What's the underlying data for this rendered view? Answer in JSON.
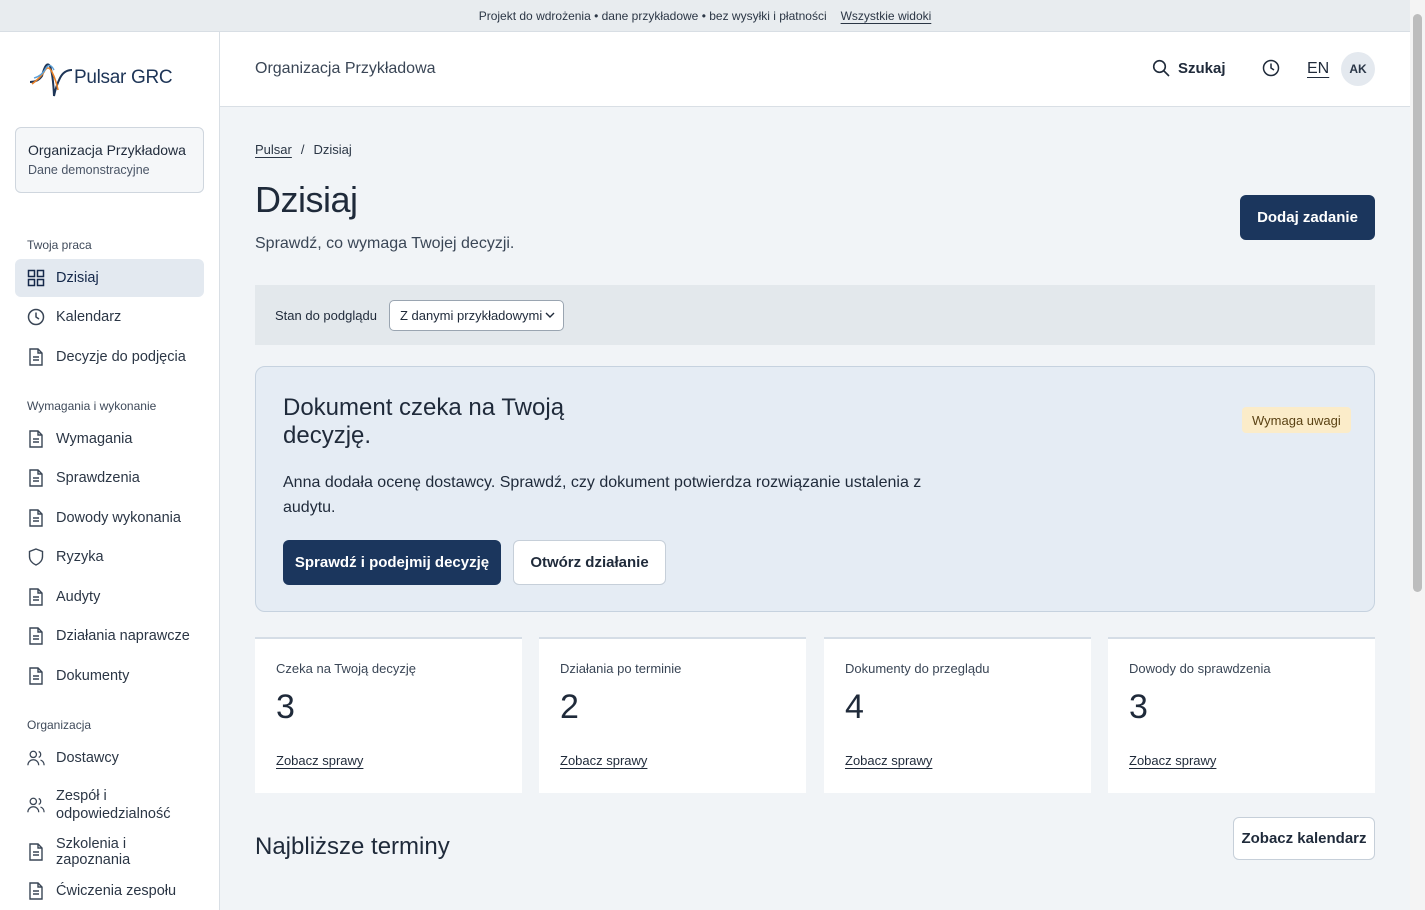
{
  "banner": {
    "text": "Projekt do wdrożenia • dane przykładowe • bez wysyłki i płatności",
    "link": "Wszystkie widoki"
  },
  "sidebar": {
    "logo_text": "Pulsar GRC",
    "org_name": "Organizacja Przykładowa",
    "org_sub": "Dane demonstracyjne",
    "sections": [
      {
        "title": "Twoja praca",
        "items": [
          {
            "label": "Dzisiaj",
            "icon": "grid-icon",
            "active": true
          },
          {
            "label": "Kalendarz",
            "icon": "clock-icon"
          },
          {
            "label": "Decyzje do podjęcia",
            "icon": "document-icon"
          }
        ]
      },
      {
        "title": "Wymagania i wykonanie",
        "items": [
          {
            "label": "Wymagania",
            "icon": "document-icon"
          },
          {
            "label": "Sprawdzenia",
            "icon": "document-icon"
          },
          {
            "label": "Dowody wykonania",
            "icon": "document-icon"
          },
          {
            "label": "Ryzyka",
            "icon": "shield-icon"
          },
          {
            "label": "Audyty",
            "icon": "document-icon"
          },
          {
            "label": "Działania naprawcze",
            "icon": "document-icon"
          },
          {
            "label": "Dokumenty",
            "icon": "document-icon"
          }
        ]
      },
      {
        "title": "Organizacja",
        "items": [
          {
            "label": "Dostawcy",
            "icon": "users-icon"
          },
          {
            "label": "Zespół i odpowiedzialność",
            "icon": "users-icon"
          },
          {
            "label": "Szkolenia i zapoznania",
            "icon": "document-icon"
          },
          {
            "label": "Ćwiczenia zespołu",
            "icon": "document-icon"
          }
        ]
      }
    ]
  },
  "topbar": {
    "org": "Organizacja Przykładowa",
    "search_label": "Szukaj",
    "lang": "EN",
    "avatar": "AK"
  },
  "main": {
    "breadcrumb_root": "Pulsar",
    "breadcrumb_sep": "/",
    "breadcrumb_current": "Dzisiaj",
    "title": "Dzisiaj",
    "subtitle": "Sprawdź, co wymaga Twojej decyzji.",
    "add_button": "Dodaj zadanie",
    "preview_label": "Stan do podglądu",
    "preview_value": "Z danymi przykładowymi"
  },
  "decision": {
    "title": "Dokument czeka na Twoją decyzję.",
    "badge": "Wymaga uwagi",
    "body": "Anna dodała ocenę dostawcy. Sprawdź, czy dokument potwierdza rozwiązanie ustalenia z audytu.",
    "primary": "Sprawdź i podejmij decyzję",
    "secondary": "Otwórz działanie"
  },
  "stats": [
    {
      "label": "Czeka na Twoją decyzję",
      "value": "3",
      "link": "Zobacz sprawy"
    },
    {
      "label": "Działania po terminie",
      "value": "2",
      "link": "Zobacz sprawy"
    },
    {
      "label": "Dokumenty do przeglądu",
      "value": "4",
      "link": "Zobacz sprawy"
    },
    {
      "label": "Dowody do sprawdzenia",
      "value": "3",
      "link": "Zobacz sprawy"
    }
  ],
  "deadlines": {
    "title": "Najbliższe terminy",
    "calendar_button": "Zobacz kalendarz"
  },
  "colors": {
    "primary": "#1b365d",
    "badge_bg": "#fbecc9",
    "active_nav": "#e3e9f0"
  }
}
